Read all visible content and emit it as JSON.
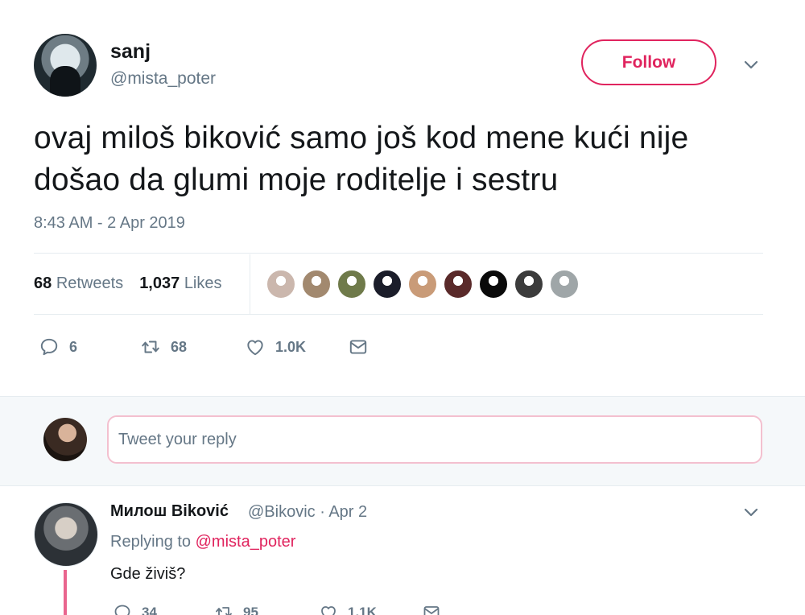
{
  "tweet": {
    "author_name": "sanj",
    "author_handle": "@mista_poter",
    "follow_label": "Follow",
    "text": "ovaj miloš biković samo još kod mene kući nije došao da glumi moje roditelje i sestru",
    "timestamp": "8:43 AM - 2 Apr 2019",
    "retweets_count": "68",
    "retweets_label": "Retweets",
    "likes_count": "1,037",
    "likes_label": "Likes",
    "liker_colors": [
      "#cbb7ad",
      "#a2896f",
      "#6f7a4a",
      "#1b1d2a",
      "#c99b78",
      "#5a2a2a",
      "#0a0a0a",
      "#3c3c3c",
      "#9fa6a8"
    ],
    "actions": {
      "reply_count": "6",
      "retweet_count": "68",
      "like_count": "1.0K"
    },
    "icons": [
      "reply-icon",
      "retweet-icon",
      "heart-icon",
      "message-icon",
      "chevron-down-icon"
    ]
  },
  "reply_box": {
    "placeholder": "Tweet your reply"
  },
  "reply": {
    "author_name": "Милош Biković",
    "meta": "@Bikovic · Apr 2",
    "replying_prefix": "Replying to",
    "replying_mention": "@mista_poter",
    "text": "Gde živiš?",
    "actions": {
      "reply_count": "34",
      "retweet_count": "95",
      "like_count": "1.1K"
    }
  },
  "colors": {
    "accent": "#e0245e",
    "secondary_text": "#657786",
    "divider": "#e6ecf0",
    "reply_bar_bg": "#f5f8fa"
  }
}
